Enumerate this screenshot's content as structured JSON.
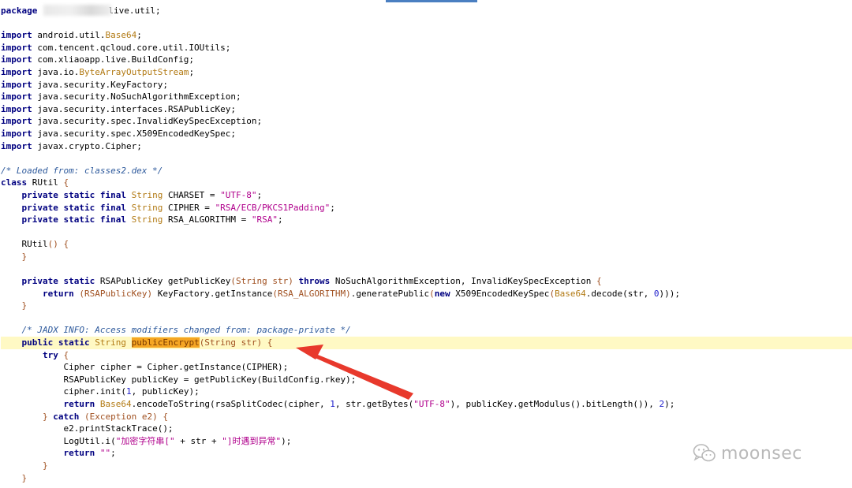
{
  "editor": {
    "package_keyword": "package",
    "package_suffix": "live.util;",
    "imports": [
      {
        "kw": "import",
        "path": "android.util.",
        "cls": "Base64",
        "end": ";"
      },
      {
        "kw": "import",
        "path": "com.tencent.qcloud.core.util.IOUtils;",
        "cls": "",
        "end": ""
      },
      {
        "kw": "import",
        "path": "com.xliaoapp.live.BuildConfig;",
        "cls": "",
        "end": ""
      },
      {
        "kw": "import",
        "path": "java.io.",
        "cls": "ByteArrayOutputStream",
        "end": ";"
      },
      {
        "kw": "import",
        "path": "java.security.KeyFactory;",
        "cls": "",
        "end": ""
      },
      {
        "kw": "import",
        "path": "java.security.NoSuchAlgorithmException;",
        "cls": "",
        "end": ""
      },
      {
        "kw": "import",
        "path": "java.security.interfaces.RSAPublicKey;",
        "cls": "",
        "end": ""
      },
      {
        "kw": "import",
        "path": "java.security.spec.InvalidKeySpecException;",
        "cls": "",
        "end": ""
      },
      {
        "kw": "import",
        "path": "java.security.spec.X509EncodedKeySpec;",
        "cls": "",
        "end": ""
      },
      {
        "kw": "import",
        "path": "javax.crypto.Cipher;",
        "cls": "",
        "end": ""
      }
    ],
    "loaded_from_comment": "/* Loaded from: classes2.dex */",
    "class_kw": "class",
    "class_name": " RUtil ",
    "brace_open": "{",
    "brace_close": "}",
    "private_static_final": "private static final",
    "private_static": "private static",
    "public_static": "public static",
    "string_type": "String",
    "fields": [
      {
        "name": " CHARSET = ",
        "value": "\"UTF-8\""
      },
      {
        "name": " CIPHER = ",
        "value": "\"RSA/ECB/PKCS1Padding\""
      },
      {
        "name": " RSA_ALGORITHM = ",
        "value": "\"RSA\""
      }
    ],
    "ctor": "RUtil",
    "ctor_parens": "() {",
    "getpk_sig_a": " RSAPublicKey getPublicKey",
    "getpk_params": "(String str)",
    "throws_kw": "throws",
    "getpk_sig_b": " NoSuchAlgorithmException, InvalidKeySpecException ",
    "return_kw": "return",
    "getpk_ret_a": "(RSAPublicKey)",
    "getpk_ret_b": " KeyFactory.getInstance",
    "getpk_ret_c": "(RSA_ALGORITHM)",
    "getpk_ret_d": ".generatePublic",
    "new_kw": "new",
    "getpk_ret_e": " X509EncodedKeySpec",
    "base64": "Base64",
    "getpk_ret_f": ".decode(str, ",
    "zero": "0",
    "getpk_ret_g": ")));",
    "jadx_comment": "/* JADX INFO: Access modifiers changed from: package-private */",
    "method_name": "publicEncrypt",
    "encrypt_params": "(String str) {",
    "try_kw": "try",
    "body_cipher": "Cipher cipher = Cipher.getInstance(CIPHER);",
    "body_pk": "RSAPublicKey publicKey = getPublicKey(BuildConfig.rkey);",
    "body_init_a": "cipher.init(",
    "one": "1",
    "body_init_b": ", publicKey);",
    "body_ret_a": ".encodeToString(rsaSplitCodec(cipher, ",
    "body_ret_b": ", str.getBytes(",
    "utf8": "\"UTF-8\"",
    "body_ret_c": "), publicKey.getModulus().bitLength()), ",
    "two": "2",
    "body_ret_d": ");",
    "catch_kw": "catch",
    "catch_params": "(Exception e2) {",
    "body_trace": "e2.printStackTrace();",
    "body_log_a": "LogUtil.i(",
    "log_str_a": "\"加密字符串[\"",
    "body_log_b": " + str + ",
    "log_str_b": "\"]时遇到异常\"",
    "body_log_c": ");",
    "empty_str": "\"\"",
    "semicolon": ";"
  },
  "watermark": {
    "icon": "wechat-icon",
    "text": "moonsec"
  },
  "colors": {
    "keyword": "#000080",
    "type": "#b27a14",
    "string": "#b0008c",
    "comment": "#7a7a7a",
    "highlight": "#fff9c4",
    "arrow": "#e8392c"
  }
}
